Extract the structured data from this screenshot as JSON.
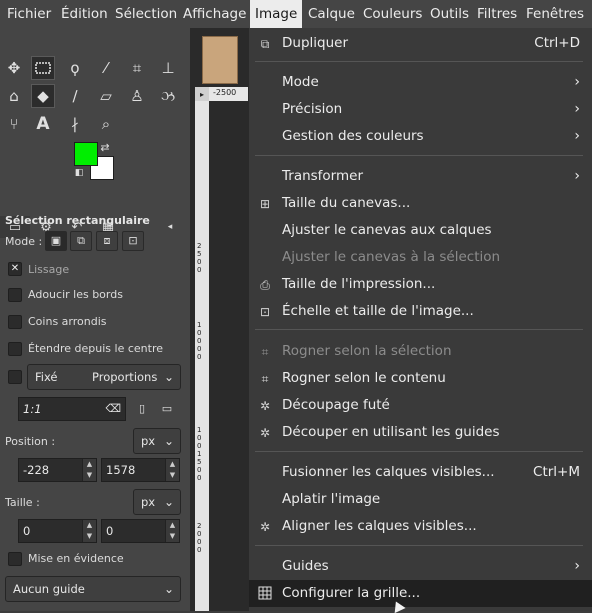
{
  "menubar": {
    "items": [
      "Fichier",
      "Édition",
      "Sélection",
      "Affichage",
      "Image",
      "Calque",
      "Couleurs",
      "Outils",
      "Filtres",
      "Fenêtres"
    ],
    "active": "Image"
  },
  "colors": {
    "foreground": "#00ee00",
    "background": "#ffffff",
    "accent_highlight": "#202020"
  },
  "tool_options": {
    "title": "Sélection rectangulaire",
    "mode_label": "Mode :",
    "antialias_label": "Lissage",
    "feather_label": "Adoucir les bords",
    "rounded_label": "Coins arrondis",
    "expand_label": "Étendre depuis le centre",
    "fixed_label": "Fixé",
    "fixed_mode": "Proportions",
    "ratio_value": "1:1",
    "position_label": "Position :",
    "position_unit": "px",
    "position_x": "-228",
    "position_y": "1578",
    "size_label": "Taille :",
    "size_unit": "px",
    "size_w": "0",
    "size_h": "0",
    "highlight_label": "Mise en évidence",
    "guide_value": "Aucun guide"
  },
  "ruler": {
    "top_value": "-2500",
    "left_values": [
      "2",
      "5",
      "0",
      "0",
      "1",
      "0",
      "0",
      "0",
      "0",
      "1",
      "0",
      "0",
      "1",
      "5",
      "0",
      "0",
      "2",
      "0",
      "0",
      "0"
    ]
  },
  "image_menu": {
    "items": [
      {
        "label": "Dupliquer",
        "shortcut": "Ctrl+D",
        "icon": "duplicate-icon"
      },
      {
        "label": "Mode",
        "submenu": true
      },
      {
        "label": "Précision",
        "submenu": true
      },
      {
        "label": "Gestion des couleurs",
        "submenu": true
      },
      {
        "label": "Transformer",
        "submenu": true
      },
      {
        "label": "Taille du canevas...",
        "icon": "canvas-size-icon"
      },
      {
        "label": "Ajuster le canevas aux calques"
      },
      {
        "label": "Ajuster le canevas à la sélection",
        "disabled": true
      },
      {
        "label": "Taille de l'impression...",
        "icon": "print-size-icon"
      },
      {
        "label": "Échelle et taille de l'image...",
        "icon": "scale-image-icon"
      },
      {
        "label": "Rogner selon la sélection",
        "disabled": true,
        "icon": "crop-selection-icon"
      },
      {
        "label": "Rogner selon le contenu",
        "icon": "crop-content-icon"
      },
      {
        "label": "Découpage futé",
        "icon": "guillotine-icon"
      },
      {
        "label": "Découper en utilisant les guides",
        "icon": "slice-guides-icon"
      },
      {
        "label": "Fusionner les calques visibles...",
        "shortcut": "Ctrl+M"
      },
      {
        "label": "Aplatir l'image"
      },
      {
        "label": "Aligner les calques visibles...",
        "icon": "align-layers-icon"
      },
      {
        "label": "Guides",
        "submenu": true
      },
      {
        "label": "Configurer la grille...",
        "icon": "grid-icon",
        "highlighted": true
      }
    ]
  }
}
